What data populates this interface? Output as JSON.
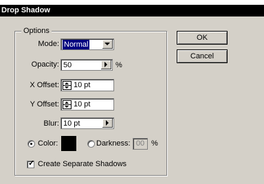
{
  "dialog": {
    "title": "Drop Shadow"
  },
  "options": {
    "legend": "Options",
    "mode": {
      "label": "Mode:",
      "value": "Normal"
    },
    "opacity": {
      "label": "Opacity:",
      "value": "50",
      "unit": "%"
    },
    "x_offset": {
      "label": "X Offset:",
      "value": "10 pt"
    },
    "y_offset": {
      "label": "Y Offset:",
      "value": "10 pt"
    },
    "blur": {
      "label": "Blur:",
      "value": "10 pt"
    },
    "color": {
      "label": "Color:",
      "selected": true,
      "swatch": "#000000"
    },
    "darkness": {
      "label": "Darkness:",
      "value": "00",
      "unit": "%",
      "selected": false
    },
    "separate_shadows": {
      "label": "Create Separate Shadows",
      "checked": true,
      "mark": "✓"
    }
  },
  "buttons": {
    "ok": "OK",
    "cancel": "Cancel"
  }
}
